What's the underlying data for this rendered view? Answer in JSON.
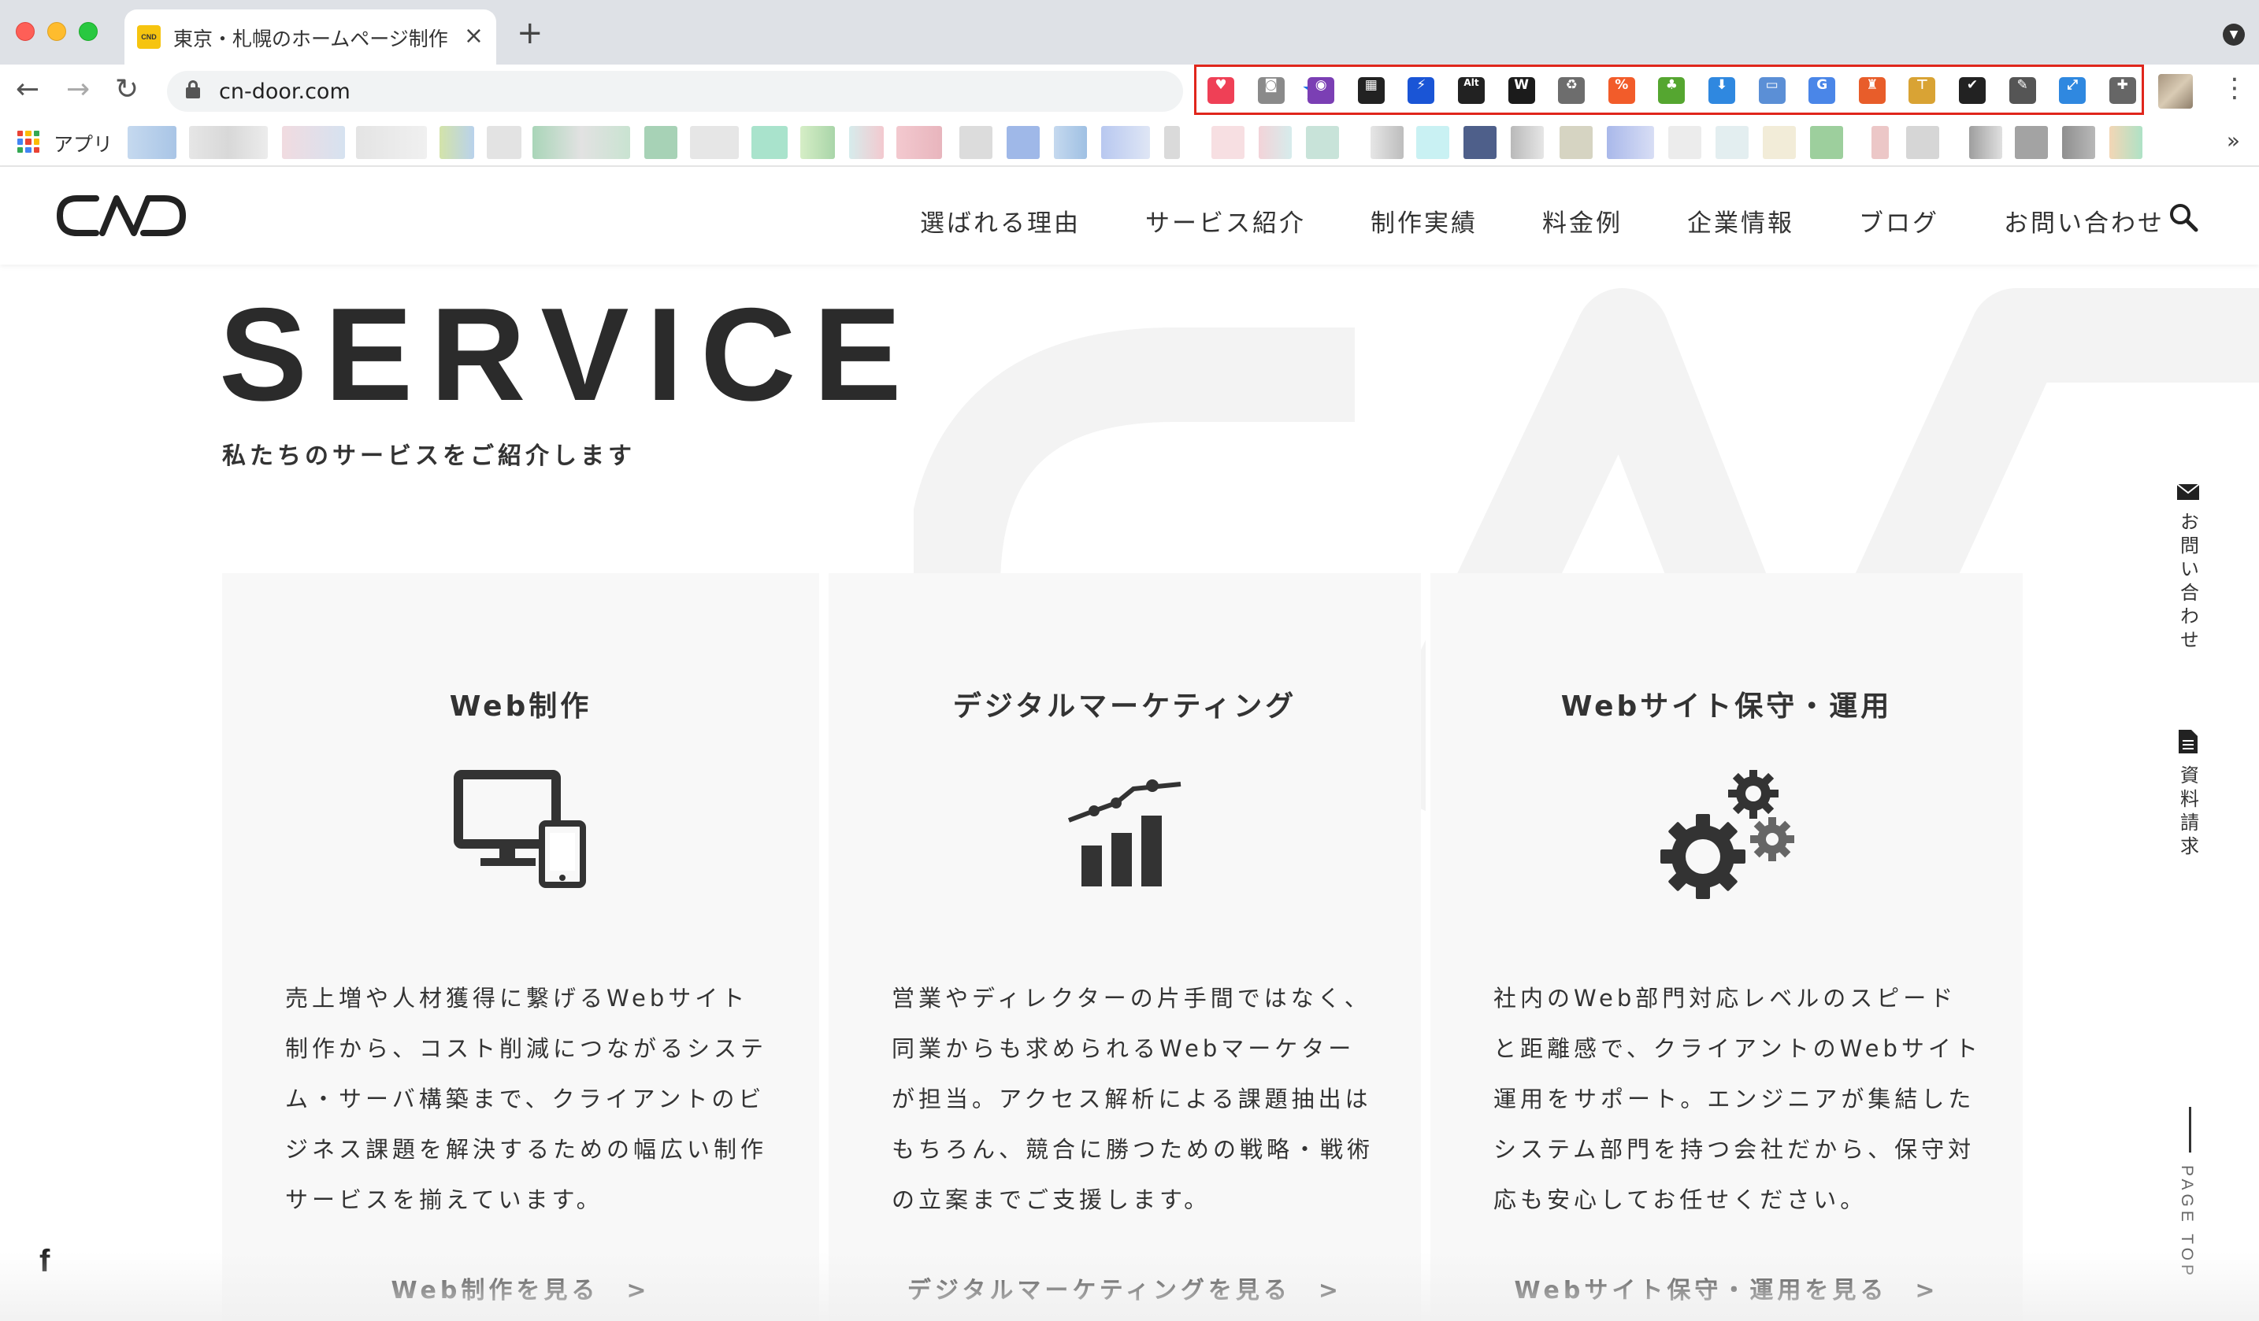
{
  "browser": {
    "tab_title": "東京・札幌のホームページ制作",
    "tab_favicon_text": "CND",
    "url": "cn-door.com",
    "bookmarks_apps_label": "アプリ",
    "extensions": [
      {
        "name": "pocket-extension-icon",
        "glyph": "♥",
        "color": "#ef4056"
      },
      {
        "name": "camera-extension-icon",
        "glyph": "◙",
        "color": "#8a8a8a"
      },
      {
        "name": "color-circle-extension-icon",
        "glyph": "◉",
        "color": "#7b3fb4"
      },
      {
        "name": "qr-code-extension-icon",
        "glyph": "▦",
        "color": "#222222"
      },
      {
        "name": "lightning-extension-icon",
        "glyph": "⚡",
        "color": "#1a55d6"
      },
      {
        "name": "alt-text-extension-icon",
        "glyph": "Alt",
        "color": "#222222"
      },
      {
        "name": "wordpress-extension-icon",
        "glyph": "W",
        "color": "#1b1b1b"
      },
      {
        "name": "recycle-extension-icon",
        "glyph": "♻",
        "color": "#6d6d6d"
      },
      {
        "name": "percent-extension-icon",
        "glyph": "%",
        "color": "#f25c2a"
      },
      {
        "name": "clover-extension-icon",
        "glyph": "♣",
        "color": "#55a630"
      },
      {
        "name": "download-extension-icon",
        "glyph": "⬇",
        "color": "#2f88e0"
      },
      {
        "name": "window-extension-icon",
        "glyph": "▭",
        "color": "#5b8fd6"
      },
      {
        "name": "google-translate-extension-icon",
        "glyph": "G",
        "color": "#4a86e8"
      },
      {
        "name": "rocket-extension-icon",
        "glyph": "♜",
        "color": "#e85d2a"
      },
      {
        "name": "ruler-extension-icon",
        "glyph": "⊤",
        "color": "#d9a334"
      },
      {
        "name": "checkbox-extension-icon",
        "glyph": "✔",
        "color": "#222222"
      },
      {
        "name": "eyedropper-extension-icon",
        "glyph": "✎",
        "color": "#555555"
      },
      {
        "name": "resize-extension-icon",
        "glyph": "⤢",
        "color": "#2f88e0"
      },
      {
        "name": "puzzle-extension-icon",
        "glyph": "✚",
        "color": "#666666"
      }
    ]
  },
  "site": {
    "logo_text": "CND",
    "nav": [
      "選ばれる理由",
      "サービス紹介",
      "制作実績",
      "料金例",
      "企業情報",
      "ブログ",
      "お問い合わせ"
    ]
  },
  "service": {
    "title": "SERVICE",
    "subtitle": "私たちのサービスをご紹介します",
    "cards": [
      {
        "title": "Web制作",
        "icon": "monitor-icon",
        "text": "売上増や人材獲得に繋げるWebサイト制作から、コスト削減につながるシステム・サーバ構築まで、クライアントのビジネス課題を解決するための幅広い制作サービスを揃えています。",
        "link": "Web制作を見る　>"
      },
      {
        "title": "デジタルマーケティング",
        "icon": "growth-chart-icon",
        "text": "営業やディレクターの片手間ではなく、同業からも求められるWebマーケターが担当。アクセス解析による課題抽出はもちろん、競合に勝つための戦略・戦術の立案までご支援します。",
        "link": "デジタルマーケティングを見る　>"
      },
      {
        "title": "Webサイト保守・運用",
        "icon": "gears-icon",
        "text": "社内のWeb部門対応レベルのスピードと距離感で、クライアントのWebサイト運用をサポート。エンジニアが集結したシステム部門を持つ会社だから、保守対応も安心してお任せください。",
        "link": "Webサイト保守・運用を見る　>"
      }
    ]
  },
  "side": {
    "contact_label": "お問い合わせ",
    "document_label": "資料請求",
    "page_top_label": "PAGE TOP",
    "facebook_label": "f"
  }
}
